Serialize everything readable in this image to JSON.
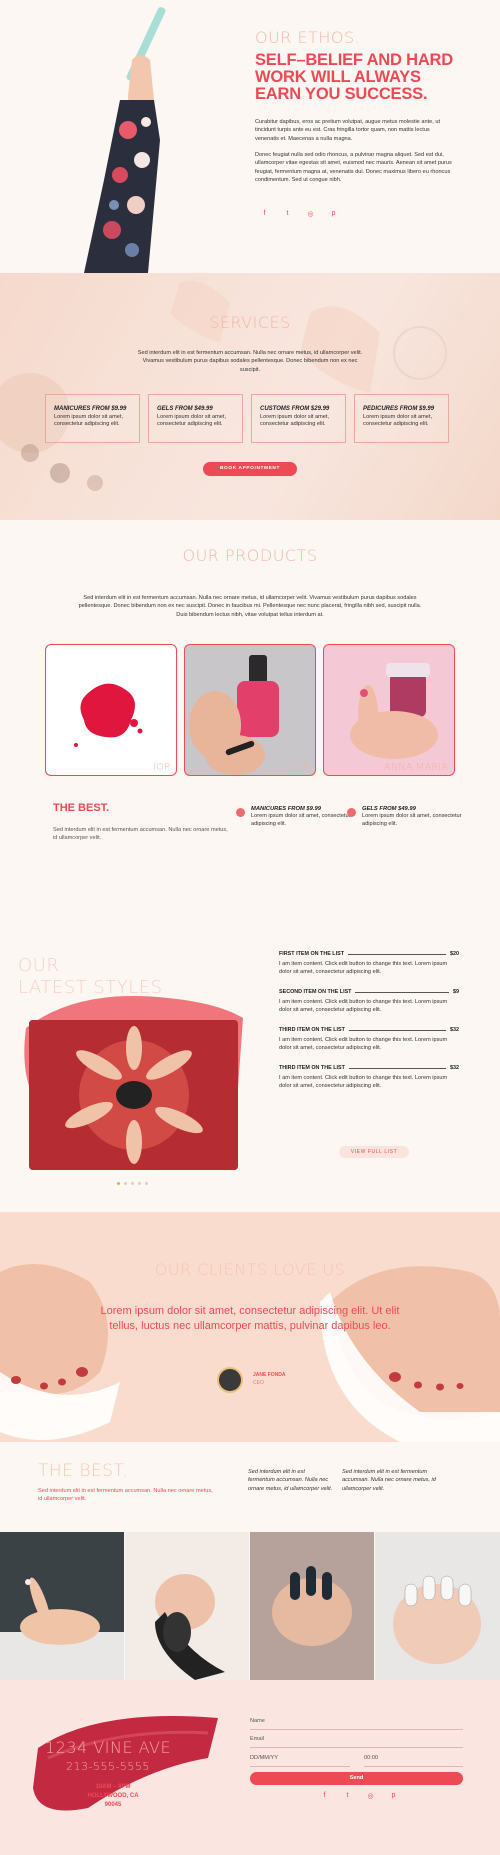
{
  "ethos": {
    "kicker": "OUR ETHOS.",
    "headline": "SELF–BELIEF AND HARD WORK WILL ALWAYS EARN YOU SUCCESS.",
    "p1": "Curabitur dapibus, eros ac pretium volutpat, augue metus molestie ante, ut tincidunt turpis ante eu est. Cras fringilla tortor quam, non mattis lectus venenatis et. Maecenas a nulla magna.",
    "p2": "Donec feugiat nulla sed odio rhoncus, a pulvinar magna aliquet. Sed est dui, ullamcorper vitae egestas sit amet, euismod nec mauris. Aenean sit amet purus feugiat, fermentum magna at, venenatis dui. Donec maximus libero eu rhoncus condimentum. Sed ut congue nibh."
  },
  "social": {
    "facebook": "f",
    "twitter": "t",
    "instagram": "◎",
    "pinterest": "p"
  },
  "services": {
    "title": "SERVICES",
    "intro": "Sed interdum elit in est fermentum accumsan. Nulla nec ornare metus, id ullamcorper velit. Vivamus vestibulum purus dapibus sodales pellentesque. Donec bibendum non ex nec suscipit.",
    "cards": [
      {
        "name": "MANICURES",
        "price": "FROM $9.99",
        "desc": "Lorem ipsum dolor sit amet, consectetur adipiscing elit."
      },
      {
        "name": "GELS",
        "price": "FROM $49.99",
        "desc": "Lorem ipsum dolor sit amet, consectetur adipiscing elit."
      },
      {
        "name": "CUSTOMS",
        "price": "FROM $29.99",
        "desc": "Lorem ipsum dolor sit amet, consectetur adipiscing elit."
      },
      {
        "name": "PEDICURES",
        "price": "FROM $9.99",
        "desc": "Lorem ipsum dolor sit amet, consectetur adipiscing elit."
      }
    ],
    "book_label": "BOOK APPOINTMENT"
  },
  "products": {
    "title": "OUR PRODUCTS",
    "intro": "Sed interdum elit in est fermentum accumsan. Nulla nec ornare metus, id ullamcorper velit. Vivamus vestibulum purus dapibus sodales pellentesque. Donec bibendum non ex nec suscipit. Donec in faucibus mi. Pellentesque nec nunc placerat, fringilla nibh sed, suscipit nulla. Duis bibendum lectus nibh, vitae volutpat tellus interdum at.",
    "items": [
      {
        "caption": "IOP"
      },
      {
        "caption": "LLA"
      },
      {
        "caption": "ANNA MARIA"
      }
    ],
    "best_title": "THE BEST.",
    "best_text": "Sed interdum elit in est fermentum accumsan. Nulla nec ornare metus, id ullamcorper velit.",
    "features": [
      {
        "name": "MANICURES",
        "price": "FROM $9.99",
        "desc": "Lorem ipsum dolor sit amet, consectetur adipiscing elit."
      },
      {
        "name": "GELS",
        "price": "FROM $49.99",
        "desc": "Lorem ipsum dolor sit amet, consectetur adipiscing elit."
      }
    ]
  },
  "styles": {
    "title_line1": "OUR",
    "title_line2": "LATEST STYLES",
    "menu": [
      {
        "name": "FIRST ITEM ON THE LIST",
        "price": "$20",
        "desc": "I am item content. Click edit button to change this text. Lorem ipsum dolor sit amet, consectetur adipiscing elit."
      },
      {
        "name": "SECOND ITEM ON THE LIST",
        "price": "$9",
        "desc": "I am item content. Click edit button to change this text. Lorem ipsum dolor sit amet, consectetur adipiscing elit."
      },
      {
        "name": "THIRD ITEM ON THE LIST",
        "price": "$32",
        "desc": "I am item content. Click edit button to change this text. Lorem ipsum dolor sit amet, consectetur adipiscing elit."
      },
      {
        "name": "THIRD ITEM ON THE LIST",
        "price": "$32",
        "desc": "I am item content. Click edit button to change this text. Lorem ipsum dolor sit amet, consectetur adipiscing elit."
      }
    ],
    "view_label": "VIEW FULL LIST"
  },
  "clients": {
    "title": "OUR CLIENTS LOVE US",
    "quote": "Lorem ipsum dolor sit amet, consectetur adipiscing elit. Ut elit tellus, luctus nec ullamcorper mattis, pulvinar dapibus leo.",
    "person_name": "JANE FONDA",
    "person_role": "CEO"
  },
  "best2": {
    "title": "THE BEST.",
    "text": "Sed interdum elit in est fermentum accumsan. Nulla nec ornare metus, id ullamcorper velit.",
    "col1": "Sed interdum elit in est fermentum accumsan. Nulla nec ornare metus, id ullamcorper velit.",
    "col2": "Sed interdum elit in est fermentum accumsan. Nulla nec ornare metus, id ullamcorper velit."
  },
  "contact": {
    "address_line1": "1234 VINE AVE",
    "address_line2": "213-555-5555",
    "hours": "10AM – 8PM",
    "city": "HOLLYWOOD, CA",
    "zip": "90045",
    "name_placeholder": "Name",
    "email_placeholder": "Email",
    "date_placeholder": "DD/MM/YY",
    "time_placeholder": "00:00",
    "send_label": "Send"
  },
  "colors": {
    "accent": "#ee4a55",
    "soft_title": "#f3b6a8",
    "background": "#fcf7f3"
  }
}
